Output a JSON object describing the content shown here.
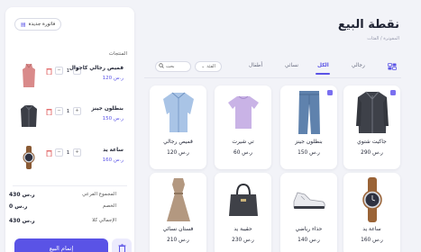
{
  "header": {
    "title": "نقطة البيع",
    "breadcrumb": "المفوترة / الفئات"
  },
  "cart": {
    "new_invoice": "فاتورة جديدة",
    "heading": "المنتجات",
    "items": [
      {
        "name": "قميص رجالي كاجوال",
        "price": "120 ر.س",
        "qty": "1",
        "image": "shirt-icon"
      },
      {
        "name": "بنطلون جينز",
        "price": "150 ر.س",
        "qty": "1",
        "image": "jacket-icon"
      },
      {
        "name": "ساعة يد",
        "price": "160 ر.س",
        "qty": "1",
        "image": "watch-icon"
      }
    ],
    "summary": {
      "subtotal_label": "المجموع الفرعي",
      "subtotal_value": "430 ر.س",
      "discount_label": "الخصم",
      "discount_value": "0 ر.س",
      "total_label": "الإجمالي كلا",
      "total_value": "430 ر.س"
    },
    "checkout_label": "إتمام البيع",
    "clear_icon": "trash-icon"
  },
  "toolbar": {
    "tabs": [
      "الكل",
      "رجالي",
      "نسائي",
      "أطفال"
    ],
    "active_tab": "الكل",
    "search_placeholder": "بحث",
    "filter_label": "الفئة"
  },
  "products": [
    {
      "name": "جاكيت شتوي",
      "price": "290 ر.س",
      "image": "jacket-icon",
      "badge": true
    },
    {
      "name": "بنطلون جينز",
      "price": "150 ر.س",
      "image": "jeans-icon",
      "badge": true
    },
    {
      "name": "تي شيرت",
      "price": "60 ر.س",
      "image": "tshirt-icon",
      "badge": false
    },
    {
      "name": "قميص رجالي",
      "price": "120 ر.س",
      "image": "shirt-icon",
      "badge": false
    },
    {
      "name": "ساعة يد",
      "price": "160 ر.س",
      "image": "watch-icon",
      "badge": false
    },
    {
      "name": "حذاء رياضي",
      "price": "140 ر.س",
      "image": "sneaker-icon",
      "badge": false
    },
    {
      "name": "حقيبة يد",
      "price": "230 ر.س",
      "image": "handbag-icon",
      "badge": false
    },
    {
      "name": "فستان نسائي",
      "price": "210 ر.س",
      "image": "dress-icon",
      "badge": false
    }
  ],
  "colors": {
    "accent": "#5a53e6",
    "background": "#f2f3f8"
  }
}
